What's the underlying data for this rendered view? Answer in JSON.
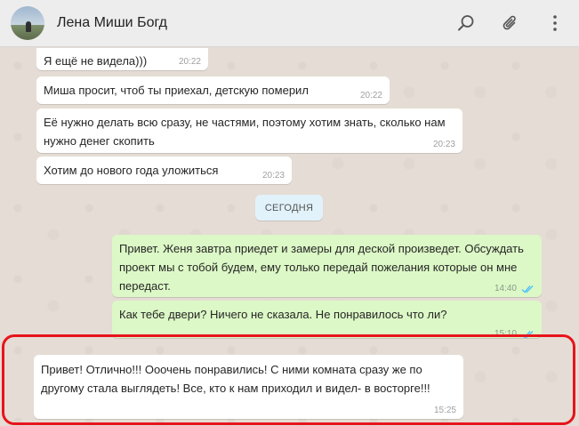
{
  "header": {
    "contact_name": "Лена Миши Богд",
    "icons": [
      "search-icon",
      "paperclip-icon",
      "more-vertical-icon"
    ]
  },
  "messages": [
    {
      "direction": "in",
      "text": "Я ещё не видела)))",
      "time": "20:22"
    },
    {
      "direction": "in",
      "text": "Миша просит, чтоб ты приехал, детскую померил",
      "time": "20:22"
    },
    {
      "direction": "in",
      "text": "Её нужно делать всю сразу, не частями, поэтому хотим знать, сколько нам нужно денег скопить",
      "time": "20:23"
    },
    {
      "direction": "in",
      "text": "Хотим до нового года уложиться",
      "time": "20:23"
    },
    {
      "direction": "out",
      "text": "Привет. Женя завтра приедет и замеры для деской произведет. Обсуждать проект мы с тобой будем, ему только передай пожелания которые он мне передаст.",
      "time": "14:40"
    },
    {
      "direction": "out",
      "text": "Как тебе двери? Ничего не сказала. Не понравилось что ли?",
      "time": "15:10"
    },
    {
      "direction": "in",
      "text": "Привет! Отлично!!! Ооочень понравились! С ними комната сразу же по другому стала выглядеть! Все, кто к нам приходил и видел- в восторге!!!",
      "time": "15:25"
    }
  ],
  "date_separator": "СЕГОДНЯ",
  "colors": {
    "incoming": "#ffffff",
    "outgoing": "#dcf8c6",
    "read_ticks": "#4fc3f7",
    "highlight": "#e8141c"
  }
}
